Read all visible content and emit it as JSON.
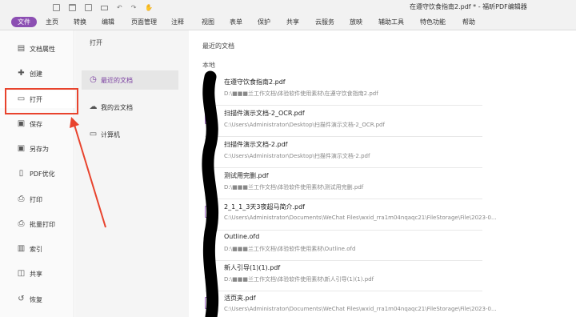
{
  "window": {
    "title": "在遵守饮食指南2.pdf * - 福昕PDF编辑器",
    "quick_access": [
      "new-doc-icon",
      "open-folder-icon",
      "save-icon",
      "print-icon",
      "undo-icon",
      "redo-icon",
      "hand-tool-icon"
    ]
  },
  "menu": {
    "file": "文件",
    "items": [
      "主页",
      "转换",
      "编辑",
      "页面管理",
      "注释",
      "视图",
      "表单",
      "保护",
      "共享",
      "云服务",
      "放映",
      "辅助工具",
      "特色功能",
      "帮助"
    ]
  },
  "sidebar": {
    "items": [
      {
        "label": "文档属性",
        "icon": "document-properties-icon"
      },
      {
        "label": "创建",
        "icon": "create-icon"
      },
      {
        "label": "打开",
        "icon": "open-folder-icon"
      },
      {
        "label": "保存",
        "icon": "save-icon"
      },
      {
        "label": "另存为",
        "icon": "save-as-icon"
      },
      {
        "label": "PDF优化",
        "icon": "pdf-optimize-icon"
      },
      {
        "label": "打印",
        "icon": "print-icon"
      },
      {
        "label": "批量打印",
        "icon": "batch-print-icon"
      },
      {
        "label": "索引",
        "icon": "index-icon"
      },
      {
        "label": "共享",
        "icon": "share-icon"
      },
      {
        "label": "恢复",
        "icon": "restore-icon"
      }
    ],
    "active": "打开",
    "highlight_color": "#e8432d"
  },
  "open_panel": {
    "title": "打开",
    "sources": [
      {
        "label": "最近的文档",
        "icon": "clock-icon"
      },
      {
        "label": "我的云文档",
        "icon": "cloud-icon"
      },
      {
        "label": "计算机",
        "icon": "computer-icon"
      }
    ]
  },
  "recent": {
    "title": "最近的文档",
    "section": "本地",
    "files": [
      {
        "name": "在遵守饮食指南2.pdf",
        "path": "D:\\■■■兰工作文档\\体验软件使用素材\\在遵守饮食指南2.pdf"
      },
      {
        "name": "扫描件演示文档-2_OCR.pdf",
        "path": "C:\\Users\\Administrator\\Desktop\\扫描件演示文档-2_OCR.pdf"
      },
      {
        "name": "扫描件演示文档-2.pdf",
        "path": "C:\\Users\\Administrator\\Desktop\\扫描件演示文档-2.pdf"
      },
      {
        "name": "测试用完删.pdf",
        "path": "D:\\■■■兰工作文档\\体验软件使用素材\\测试用完删.pdf"
      },
      {
        "name": "2_1_1_3天3夜超马简介.pdf",
        "path": "C:\\Users\\Administrator\\Documents\\WeChat Files\\wxid_rra1m04nqaqc21\\FileStorage\\File\\2023-0..."
      },
      {
        "name": "Outline.ofd",
        "path": "D:\\■■■兰工作文档\\体验软件使用素材\\Outline.ofd"
      },
      {
        "name": "新人引导(1)(1).pdf",
        "path": "D:\\■■■兰工作文档\\体验软件使用素材\\新人引导(1)(1).pdf"
      },
      {
        "name": "活页夹.pdf",
        "path": "C:\\Users\\Administrator\\Documents\\WeChat Files\\wxid_rra1m04nqaqc21\\FileStorage\\File\\2023-0..."
      }
    ]
  },
  "colors": {
    "accent": "#8c4fb3",
    "annotation_red": "#e8432d"
  }
}
